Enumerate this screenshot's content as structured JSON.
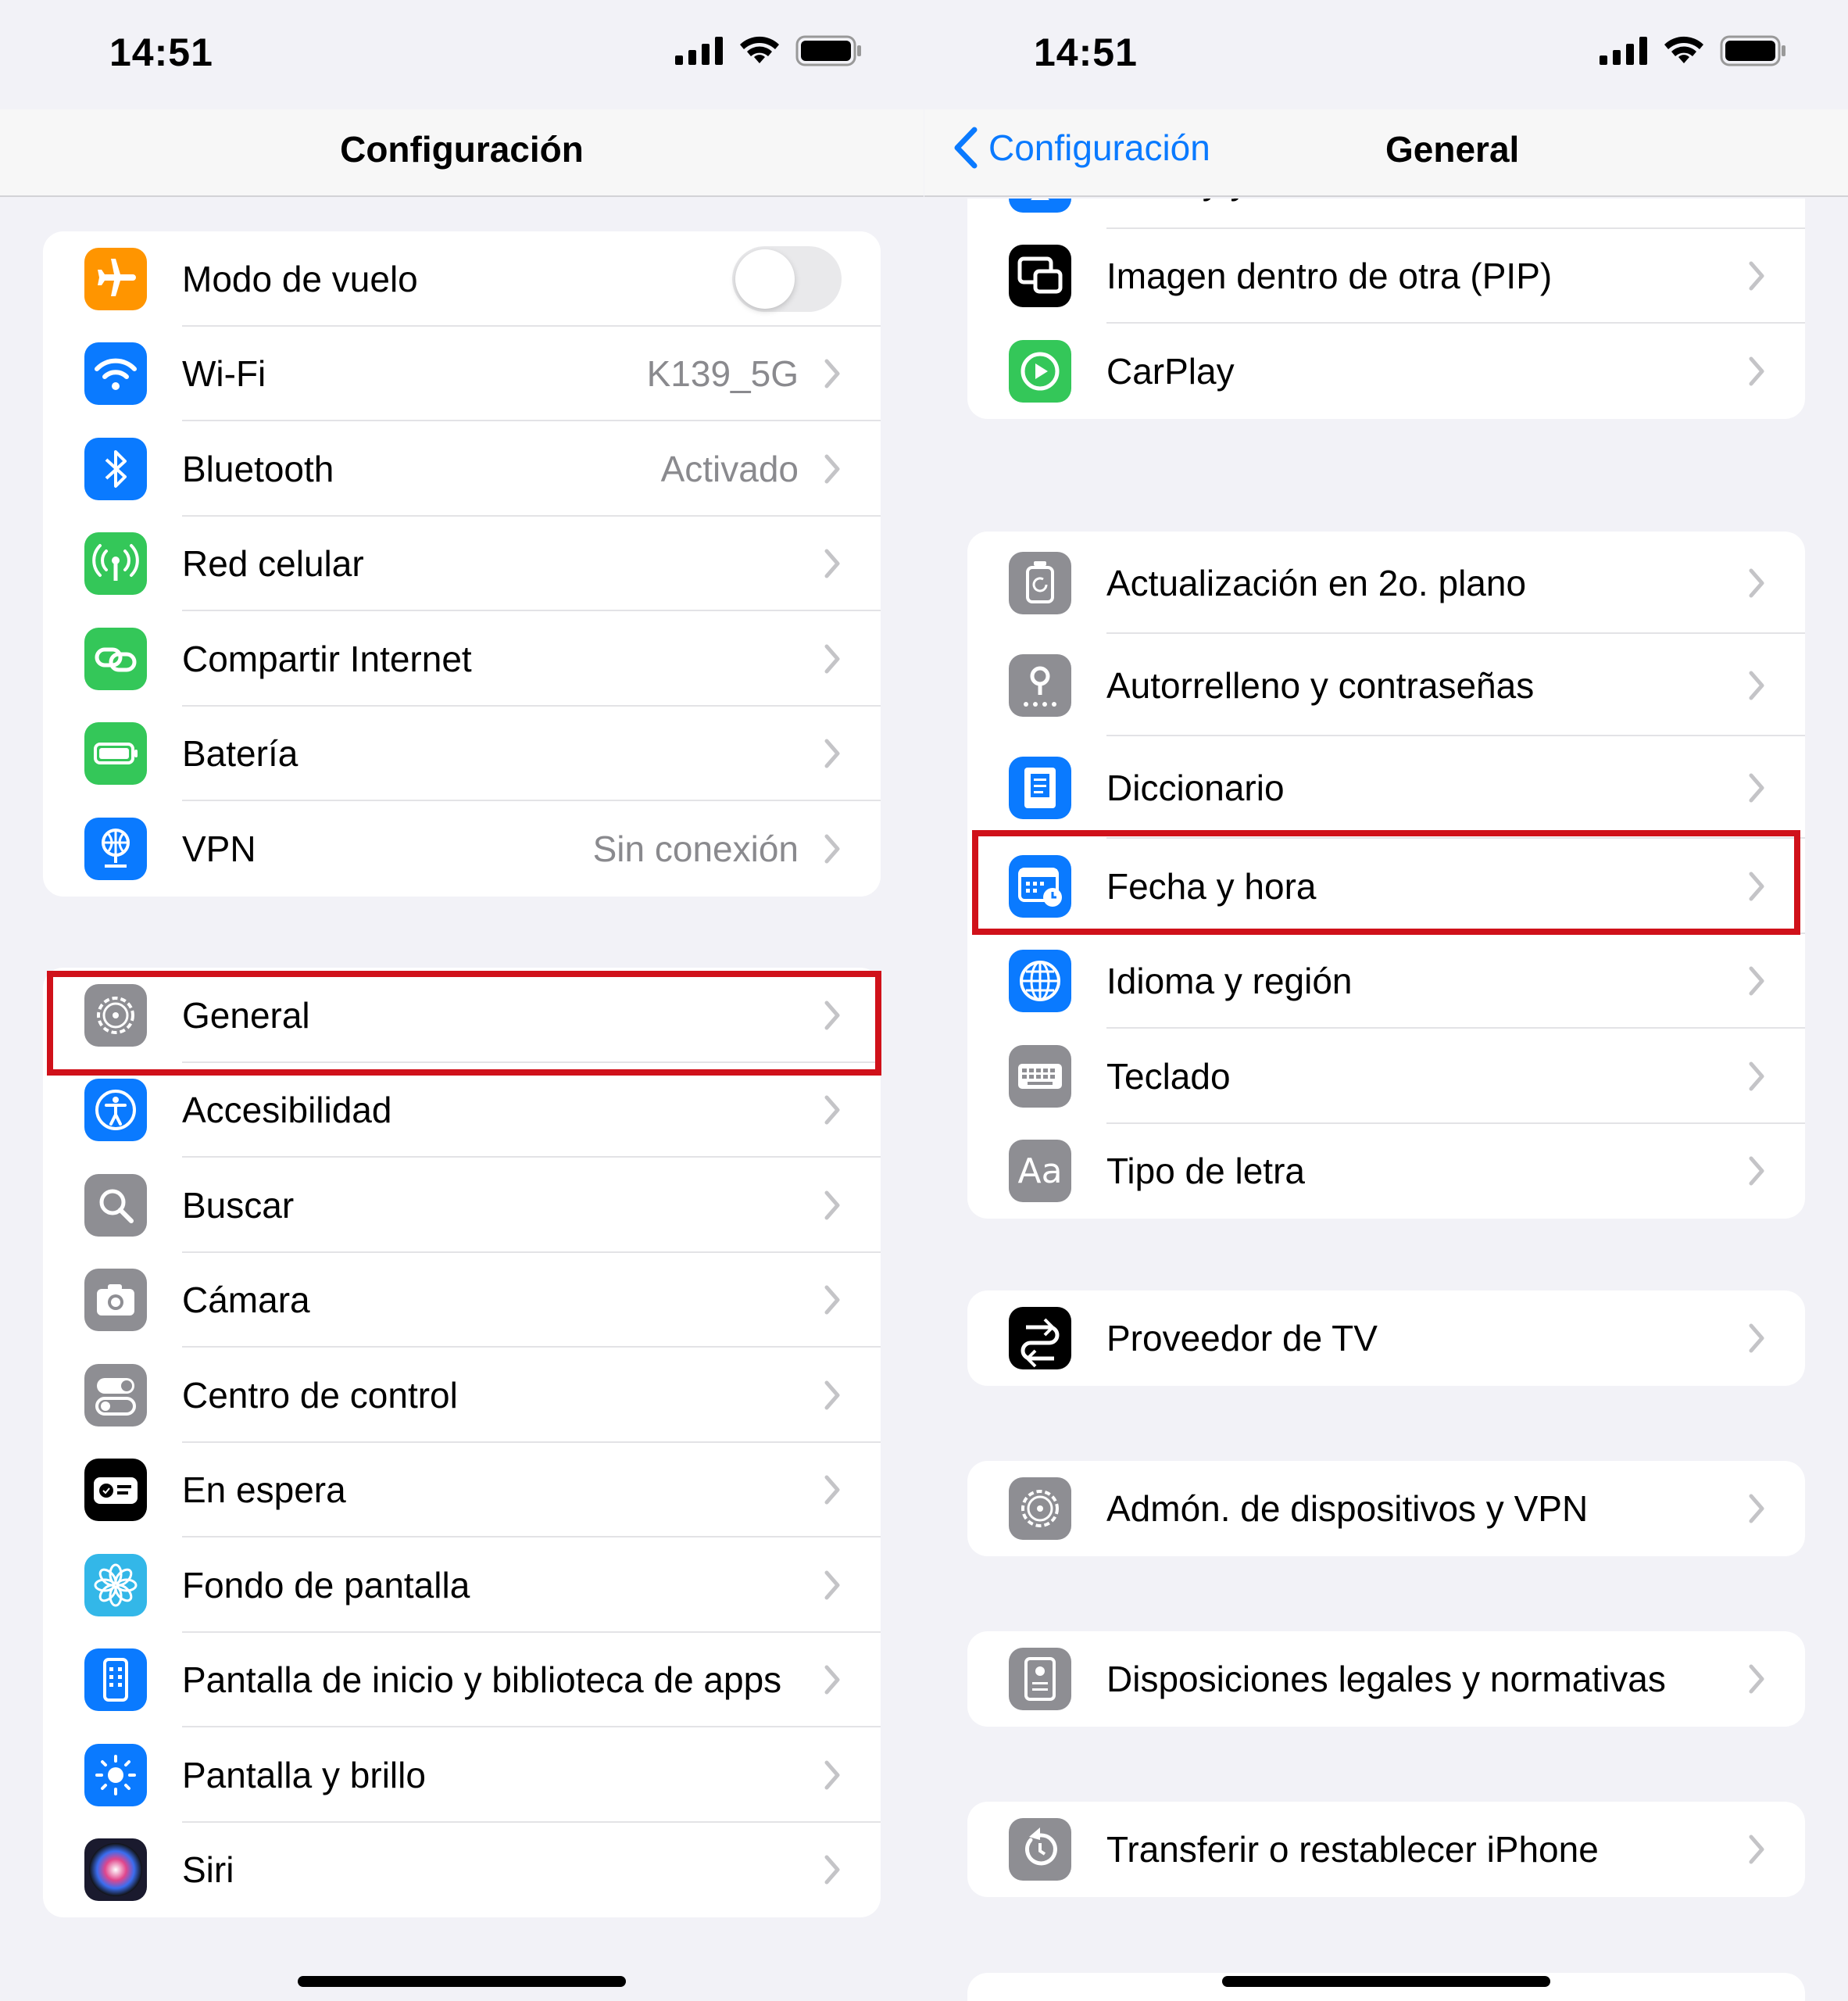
{
  "left": {
    "time": "14:51",
    "title": "Configuración",
    "group1": [
      {
        "label": "Modo de vuelo",
        "icon": "airplane-icon",
        "color": "#ff9500",
        "toggle": false
      },
      {
        "label": "Wi-Fi",
        "value": "K139_5G",
        "icon": "wifi-icon",
        "color": "#0a7aff"
      },
      {
        "label": "Bluetooth",
        "value": "Activado",
        "icon": "bluetooth-icon",
        "color": "#0a7aff"
      },
      {
        "label": "Red celular",
        "icon": "antenna-icon",
        "color": "#34c759"
      },
      {
        "label": "Compartir Internet",
        "icon": "link-icon",
        "color": "#34c759"
      },
      {
        "label": "Batería",
        "icon": "battery-icon",
        "color": "#34c759"
      },
      {
        "label": "VPN",
        "value": "Sin conexión",
        "icon": "globe-network-icon",
        "color": "#0a7aff"
      }
    ],
    "group2": [
      {
        "label": "General",
        "icon": "gear-icon",
        "color": "#8e8e93"
      },
      {
        "label": "Accesibilidad",
        "icon": "accessibility-icon",
        "color": "#0a7aff"
      },
      {
        "label": "Buscar",
        "icon": "magnifier-icon",
        "color": "#8e8e93"
      },
      {
        "label": "Cámara",
        "icon": "camera-icon",
        "color": "#8e8e93"
      },
      {
        "label": "Centro de control",
        "icon": "switches-icon",
        "color": "#8e8e93"
      },
      {
        "label": "En espera",
        "icon": "standby-icon",
        "color": "#000000"
      },
      {
        "label": "Fondo de pantalla",
        "icon": "flower-icon",
        "color": "#33b7e8"
      },
      {
        "label": "Pantalla de inicio y biblioteca de apps",
        "icon": "phone-grid-icon",
        "color": "#0a7aff"
      },
      {
        "label": "Pantalla y brillo",
        "icon": "sun-icon",
        "color": "#0a7aff"
      },
      {
        "label": "Siri",
        "icon": "siri-icon",
        "color": "#1a1a2e"
      }
    ]
  },
  "right": {
    "time": "14:51",
    "back_label": "Configuración",
    "title": "General",
    "group1": [
      {
        "label": "AirPlay y la continuidad",
        "icon": "airplay-icon",
        "color": "#0a7aff"
      },
      {
        "label": "Imagen dentro de otra (PIP)",
        "icon": "pip-icon",
        "color": "#000000"
      },
      {
        "label": "CarPlay",
        "icon": "carplay-icon",
        "color": "#34c759"
      }
    ],
    "group2": [
      {
        "label": "Actualización en 2o. plano",
        "icon": "refresh-icon",
        "color": "#8e8e93"
      },
      {
        "label": "Autorrelleno y contraseñas",
        "icon": "key-icon",
        "color": "#8e8e93"
      },
      {
        "label": "Diccionario",
        "icon": "book-icon",
        "color": "#0a7aff"
      },
      {
        "label": "Fecha y hora",
        "icon": "calendar-clock-icon",
        "color": "#0a7aff"
      },
      {
        "label": "Idioma y región",
        "icon": "globe-icon",
        "color": "#0a7aff"
      },
      {
        "label": "Teclado",
        "icon": "keyboard-icon",
        "color": "#8e8e93"
      },
      {
        "label": "Tipo de letra",
        "icon": "font-icon",
        "color": "#8e8e93",
        "glyph": "Aa"
      }
    ],
    "group3": [
      {
        "label": "Proveedor de TV",
        "icon": "tv-provider-icon",
        "color": "#000000"
      }
    ],
    "group4": [
      {
        "label": "Admón. de dispositivos y VPN",
        "icon": "gear-icon",
        "color": "#8e8e93"
      }
    ],
    "group5": [
      {
        "label": "Disposiciones legales y normativas",
        "icon": "legal-icon",
        "color": "#8e8e93"
      }
    ],
    "group6": [
      {
        "label": "Transferir o restablecer iPhone",
        "icon": "reset-icon",
        "color": "#8e8e93"
      }
    ]
  },
  "highlight_color": "#d0111a"
}
